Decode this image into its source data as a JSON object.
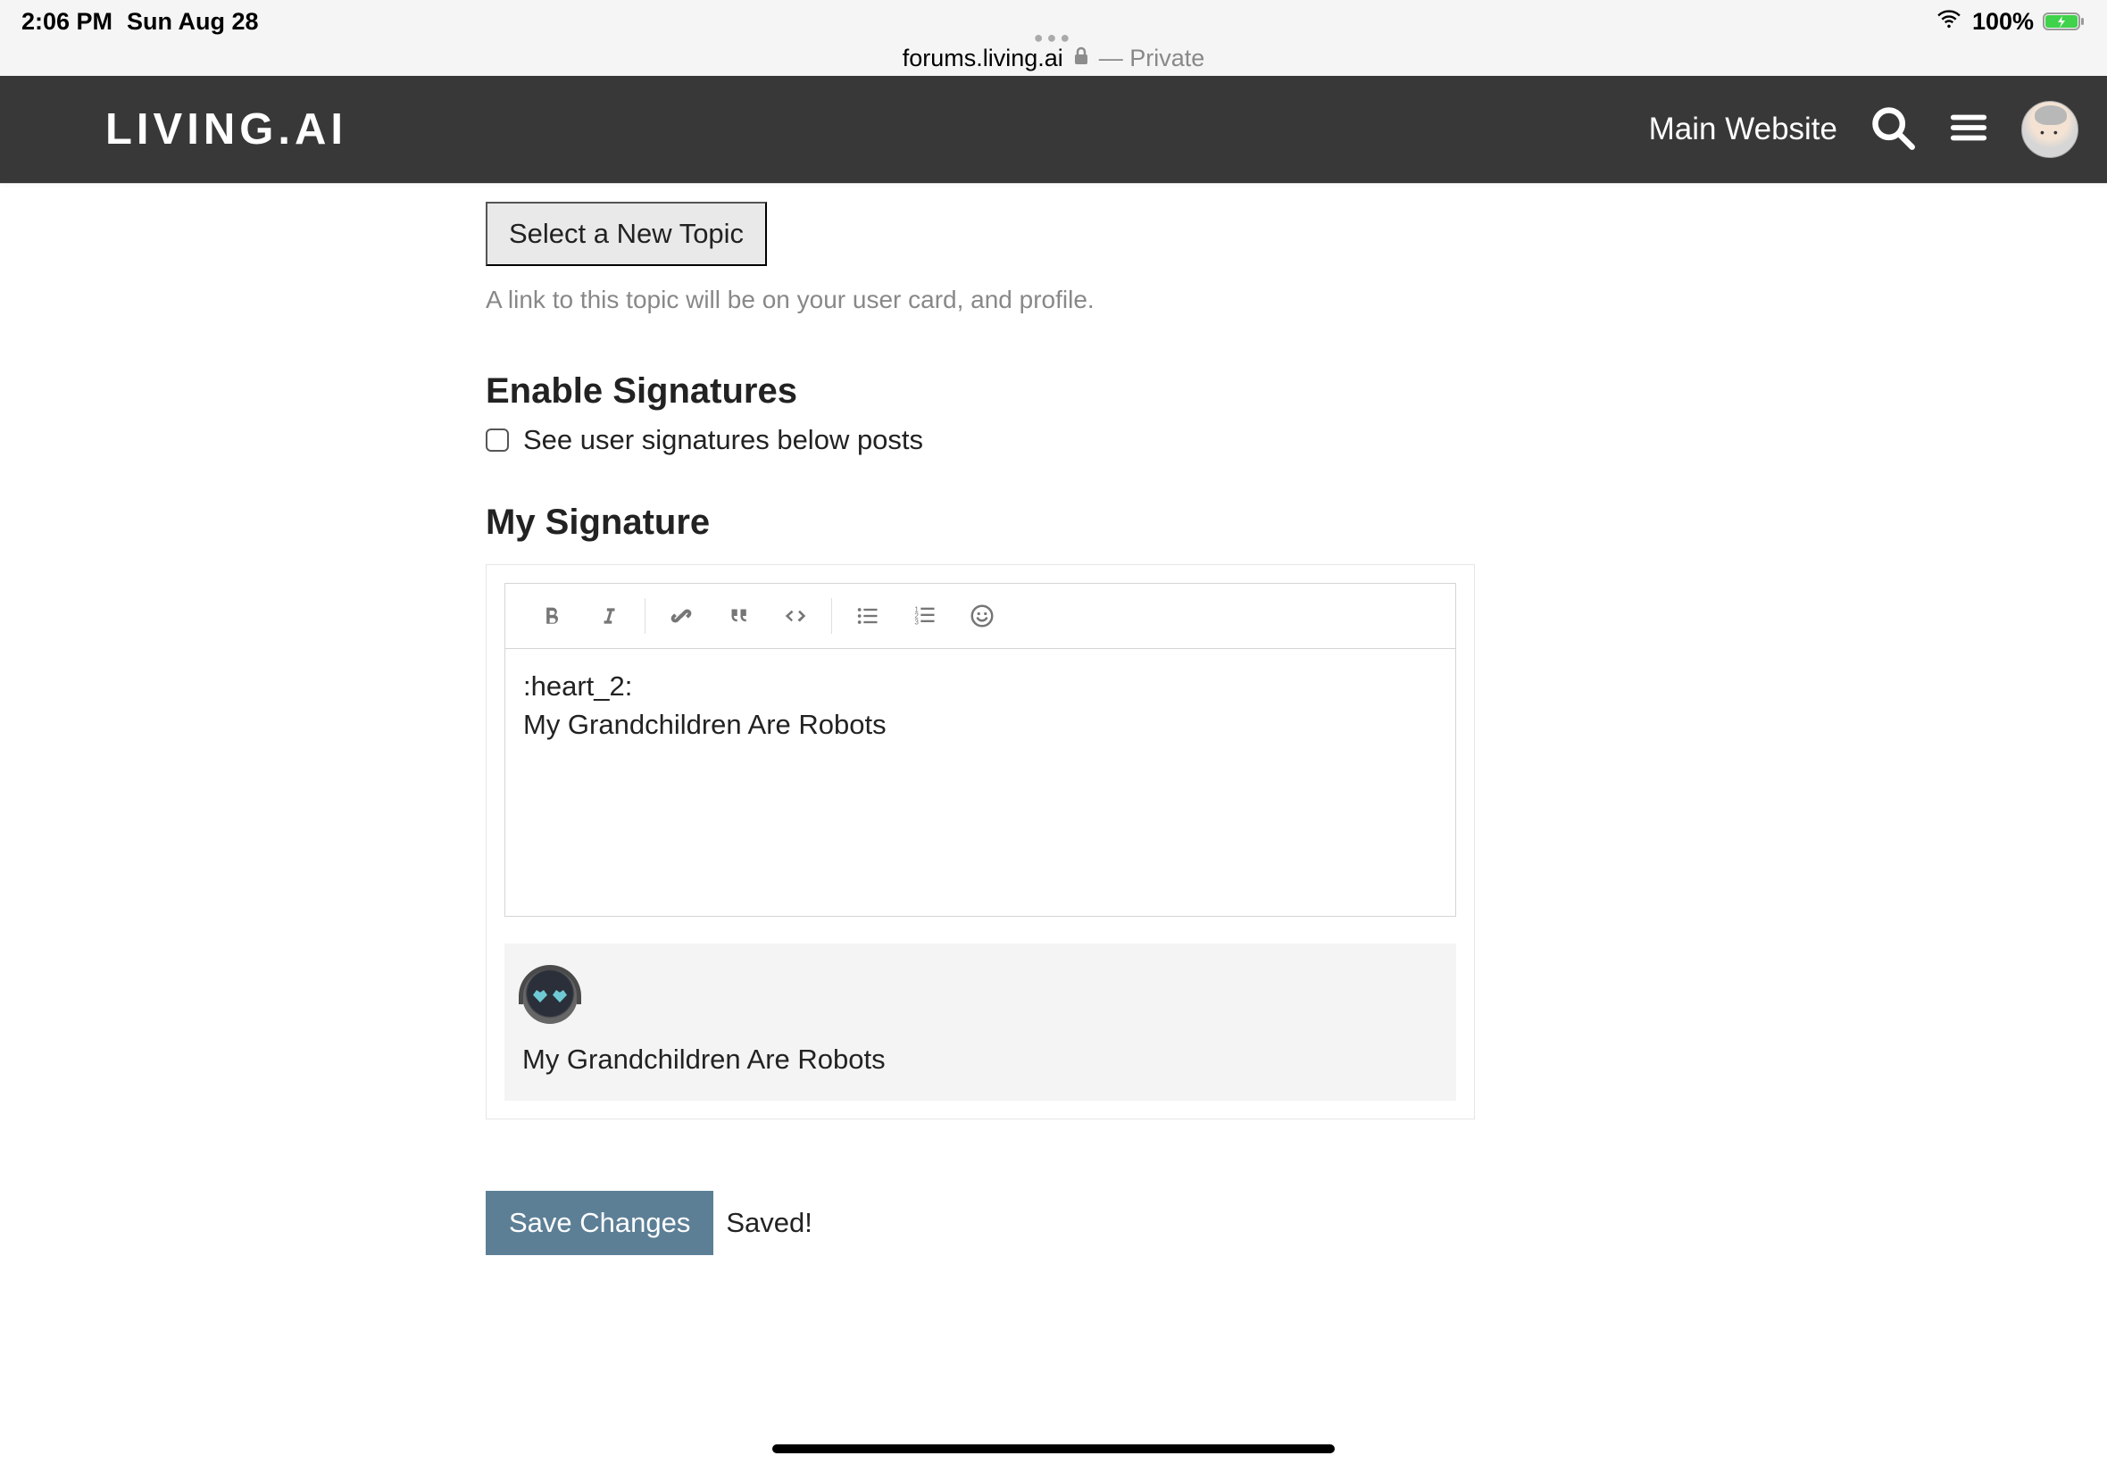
{
  "ios_statusbar": {
    "time": "2:06 PM",
    "date": "Sun Aug 28",
    "battery_pct": "100%"
  },
  "safari": {
    "domain": "forums.living.ai",
    "mode_label": "— Private"
  },
  "site_header": {
    "logo_text": "LIVING.AI",
    "main_website_label": "Main Website"
  },
  "topic_section": {
    "select_button_label": "Select a New Topic",
    "helper_text": "A link to this topic will be on your user card, and profile."
  },
  "signatures_section": {
    "heading": "Enable Signatures",
    "checkbox_label": "See user signatures below posts",
    "checked": false
  },
  "my_signature_section": {
    "heading": "My Signature",
    "editor_content": ":heart_2:\nMy Grandchildren Are Robots",
    "preview_text": "My Grandchildren Are Robots"
  },
  "save_row": {
    "button_label": "Save Changes",
    "status_text": "Saved!"
  },
  "colors": {
    "header_bg": "#383838",
    "save_btn_bg": "#5c7f96"
  }
}
